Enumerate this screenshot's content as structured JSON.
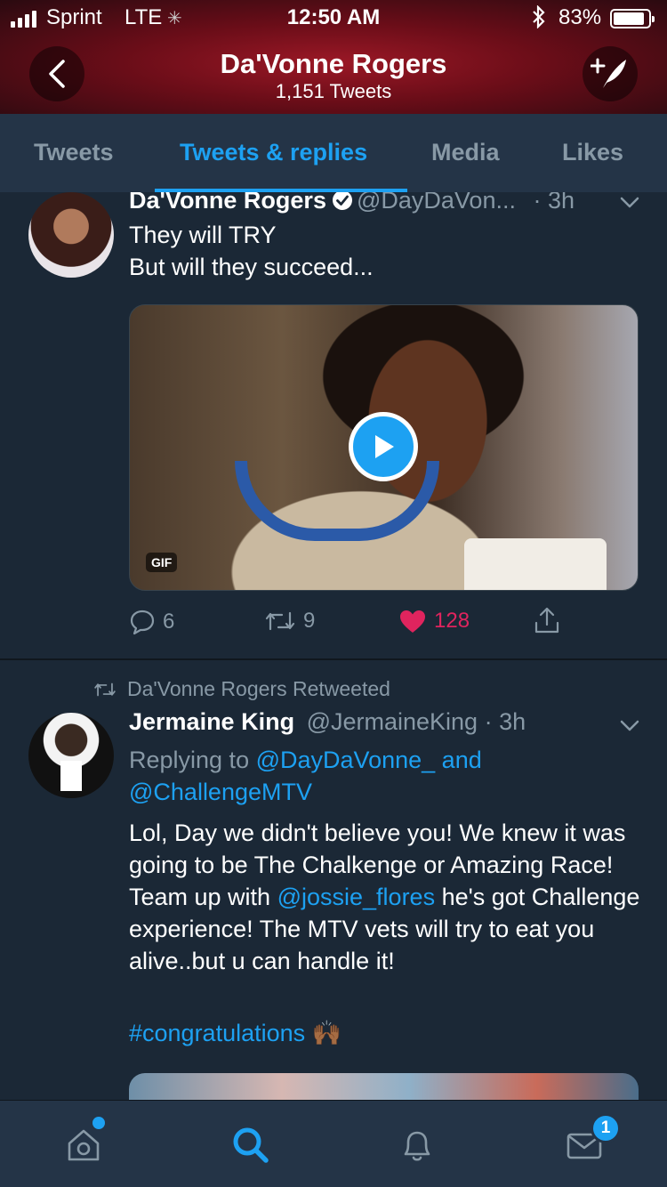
{
  "status_bar": {
    "carrier": "Sprint",
    "network": "LTE",
    "time": "12:50 AM",
    "battery_percent": "83%"
  },
  "header": {
    "name": "Da'Vonne Rogers",
    "tweet_count": "1,151 Tweets"
  },
  "tabs": [
    {
      "label": "Tweets",
      "active": false
    },
    {
      "label": "Tweets & replies",
      "active": true
    },
    {
      "label": "Media",
      "active": false
    },
    {
      "label": "Likes",
      "active": false
    }
  ],
  "tweets": [
    {
      "name": "Da'Vonne Rogers",
      "verified": true,
      "handle": "@DayDaVon...",
      "time": "· 3h",
      "text_lines": [
        "They will TRY",
        "But will they succeed..."
      ],
      "media": {
        "type": "gif",
        "badge": "GIF"
      },
      "replies": "6",
      "retweets": "9",
      "likes": "128",
      "liked": true
    },
    {
      "retweeted_by": "Da'Vonne Rogers Retweeted",
      "name": "Jermaine King",
      "handle": "@JermaineKing",
      "time": "· 3h",
      "replying_prefix": "Replying to",
      "reply_to_1": "@DayDaVonne_",
      "reply_and": "and",
      "reply_to_2": "@ChallengeMTV",
      "body_1": "Lol, Day we didn't believe you! We knew it was going to be The Chalkenge or Amazing Race! Team up with",
      "mention": "@jossie_flores",
      "body_2": " he's got Challenge experience! The MTV vets will try to eat you alive..but u can handle it!",
      "hashtag": "#congratulations",
      "emoji": "🙌🏾"
    }
  ],
  "bottom_nav": {
    "items": [
      "home-icon",
      "search-icon",
      "notifications-icon",
      "messages-icon"
    ],
    "active": "search-icon",
    "messages_badge": "1"
  },
  "colors": {
    "accent": "#1da1f2",
    "like": "#e0245e",
    "background": "#1b2836",
    "muted": "#8899a6"
  }
}
